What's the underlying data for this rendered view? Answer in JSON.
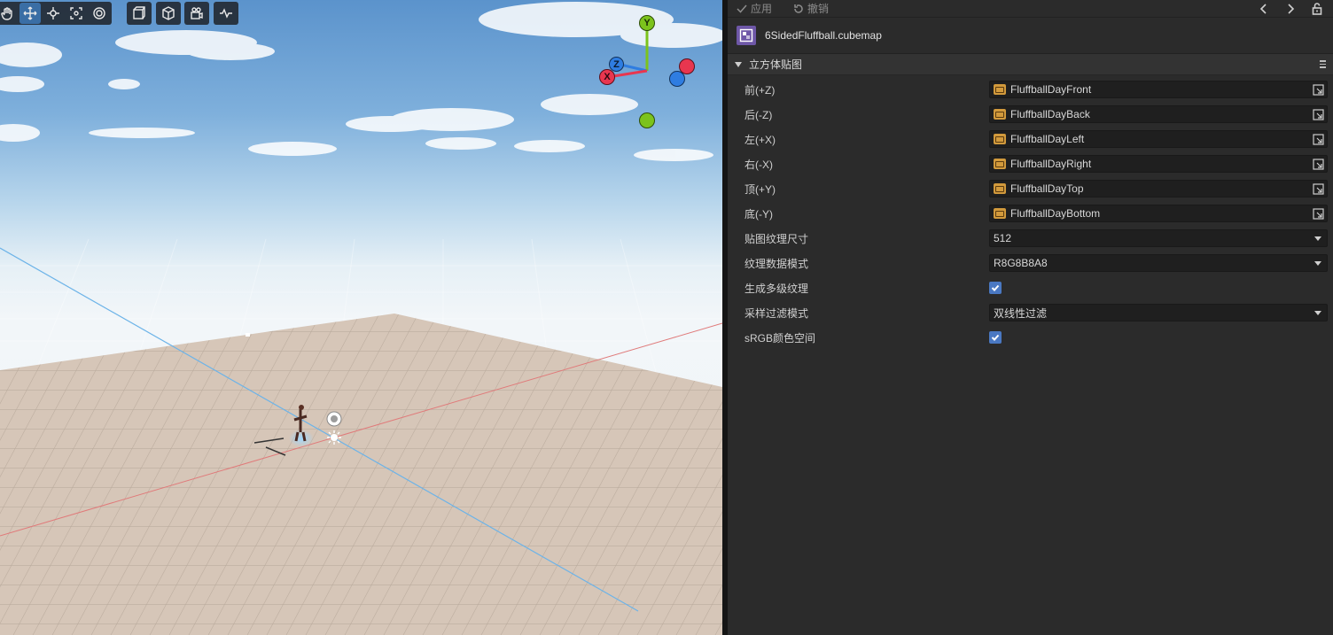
{
  "scene": {
    "gizmo": {
      "y_label": "Y",
      "z_label": "Z",
      "x_label": "X"
    },
    "colors": {
      "x_axis": "#e8364f",
      "y_axis": "#7cc31c",
      "z_axis": "#2f7de1"
    }
  },
  "inspector": {
    "topbar": {
      "apply_label": "应用",
      "revert_label": "撤销"
    },
    "asset": {
      "name": "6SidedFluffball.cubemap"
    },
    "section": {
      "title": "立方体贴图"
    },
    "faces": [
      {
        "label": "前(+Z)",
        "value": "FluffballDayFront"
      },
      {
        "label": "后(-Z)",
        "value": "FluffballDayBack"
      },
      {
        "label": "左(+X)",
        "value": "FluffballDayLeft"
      },
      {
        "label": "右(-X)",
        "value": "FluffballDayRight"
      },
      {
        "label": "顶(+Y)",
        "value": "FluffballDayTop"
      },
      {
        "label": "底(-Y)",
        "value": "FluffballDayBottom"
      }
    ],
    "texture_size": {
      "label": "贴图纹理尺寸",
      "value": "512"
    },
    "data_format": {
      "label": "纹理数据模式",
      "value": "R8G8B8A8"
    },
    "mipmaps": {
      "label": "生成多级纹理",
      "checked": true
    },
    "filter_mode": {
      "label": "采样过滤模式",
      "value": "双线性过滤"
    },
    "srgb": {
      "label": "sRGB颜色空间",
      "checked": true
    },
    "colors": {
      "accent": "#4a78c2",
      "asset_icon": "#6e57a7",
      "asset_chip": "#d29a3c"
    }
  }
}
